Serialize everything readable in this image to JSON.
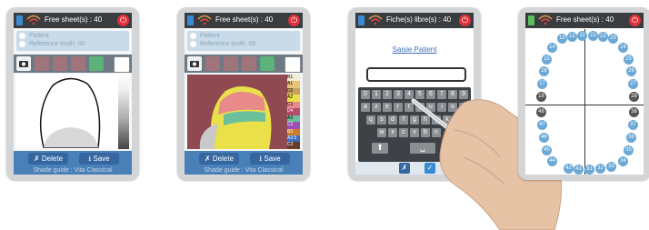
{
  "device1": {
    "status": "Free sheet(s) : 40",
    "info_line1": "Patient",
    "info_line2": "Reference tooth: 00",
    "delete": "Delete",
    "save": "Save",
    "guide": "Shade guide : Vita Classical"
  },
  "device2": {
    "status": "Free sheet(s) : 40",
    "info_line1": "Patient",
    "info_line2": "Reference tooth: 00",
    "delete": "Delete",
    "save": "Save",
    "guide": "Shade guide : Vita Classical",
    "shades": [
      "B1",
      "A1",
      "D2",
      "A2",
      "C1",
      "D4",
      "A3",
      "C2",
      "B3",
      "A3.5",
      "C3"
    ]
  },
  "device3": {
    "status": "Fiche(s) libre(s) : 40",
    "title": "Saisie Patient",
    "row1": [
      "0",
      "1",
      "2",
      "3",
      "4",
      "5",
      "6",
      "7",
      "8",
      "9"
    ],
    "row2": [
      "a",
      "z",
      "e",
      "r",
      "t",
      "y",
      "u",
      "i",
      "o",
      "p"
    ],
    "row3": [
      "q",
      "s",
      "d",
      "f",
      "g",
      "h",
      "j",
      "k",
      "l",
      "m"
    ],
    "row4": [
      "w",
      "x",
      "c",
      "v",
      "b",
      "n"
    ]
  },
  "device4": {
    "status": "Free sheet(s) : 40",
    "upper": [
      "13",
      "12",
      "11",
      "21",
      "22",
      "23"
    ],
    "left": [
      "14",
      "15",
      "16",
      "17",
      "18",
      "48",
      "47",
      "46",
      "45",
      "44"
    ],
    "right": [
      "24",
      "25",
      "26",
      "27",
      "28",
      "38",
      "37",
      "36",
      "35",
      "34"
    ],
    "lower": [
      "42",
      "41",
      "31",
      "32",
      "33"
    ]
  }
}
